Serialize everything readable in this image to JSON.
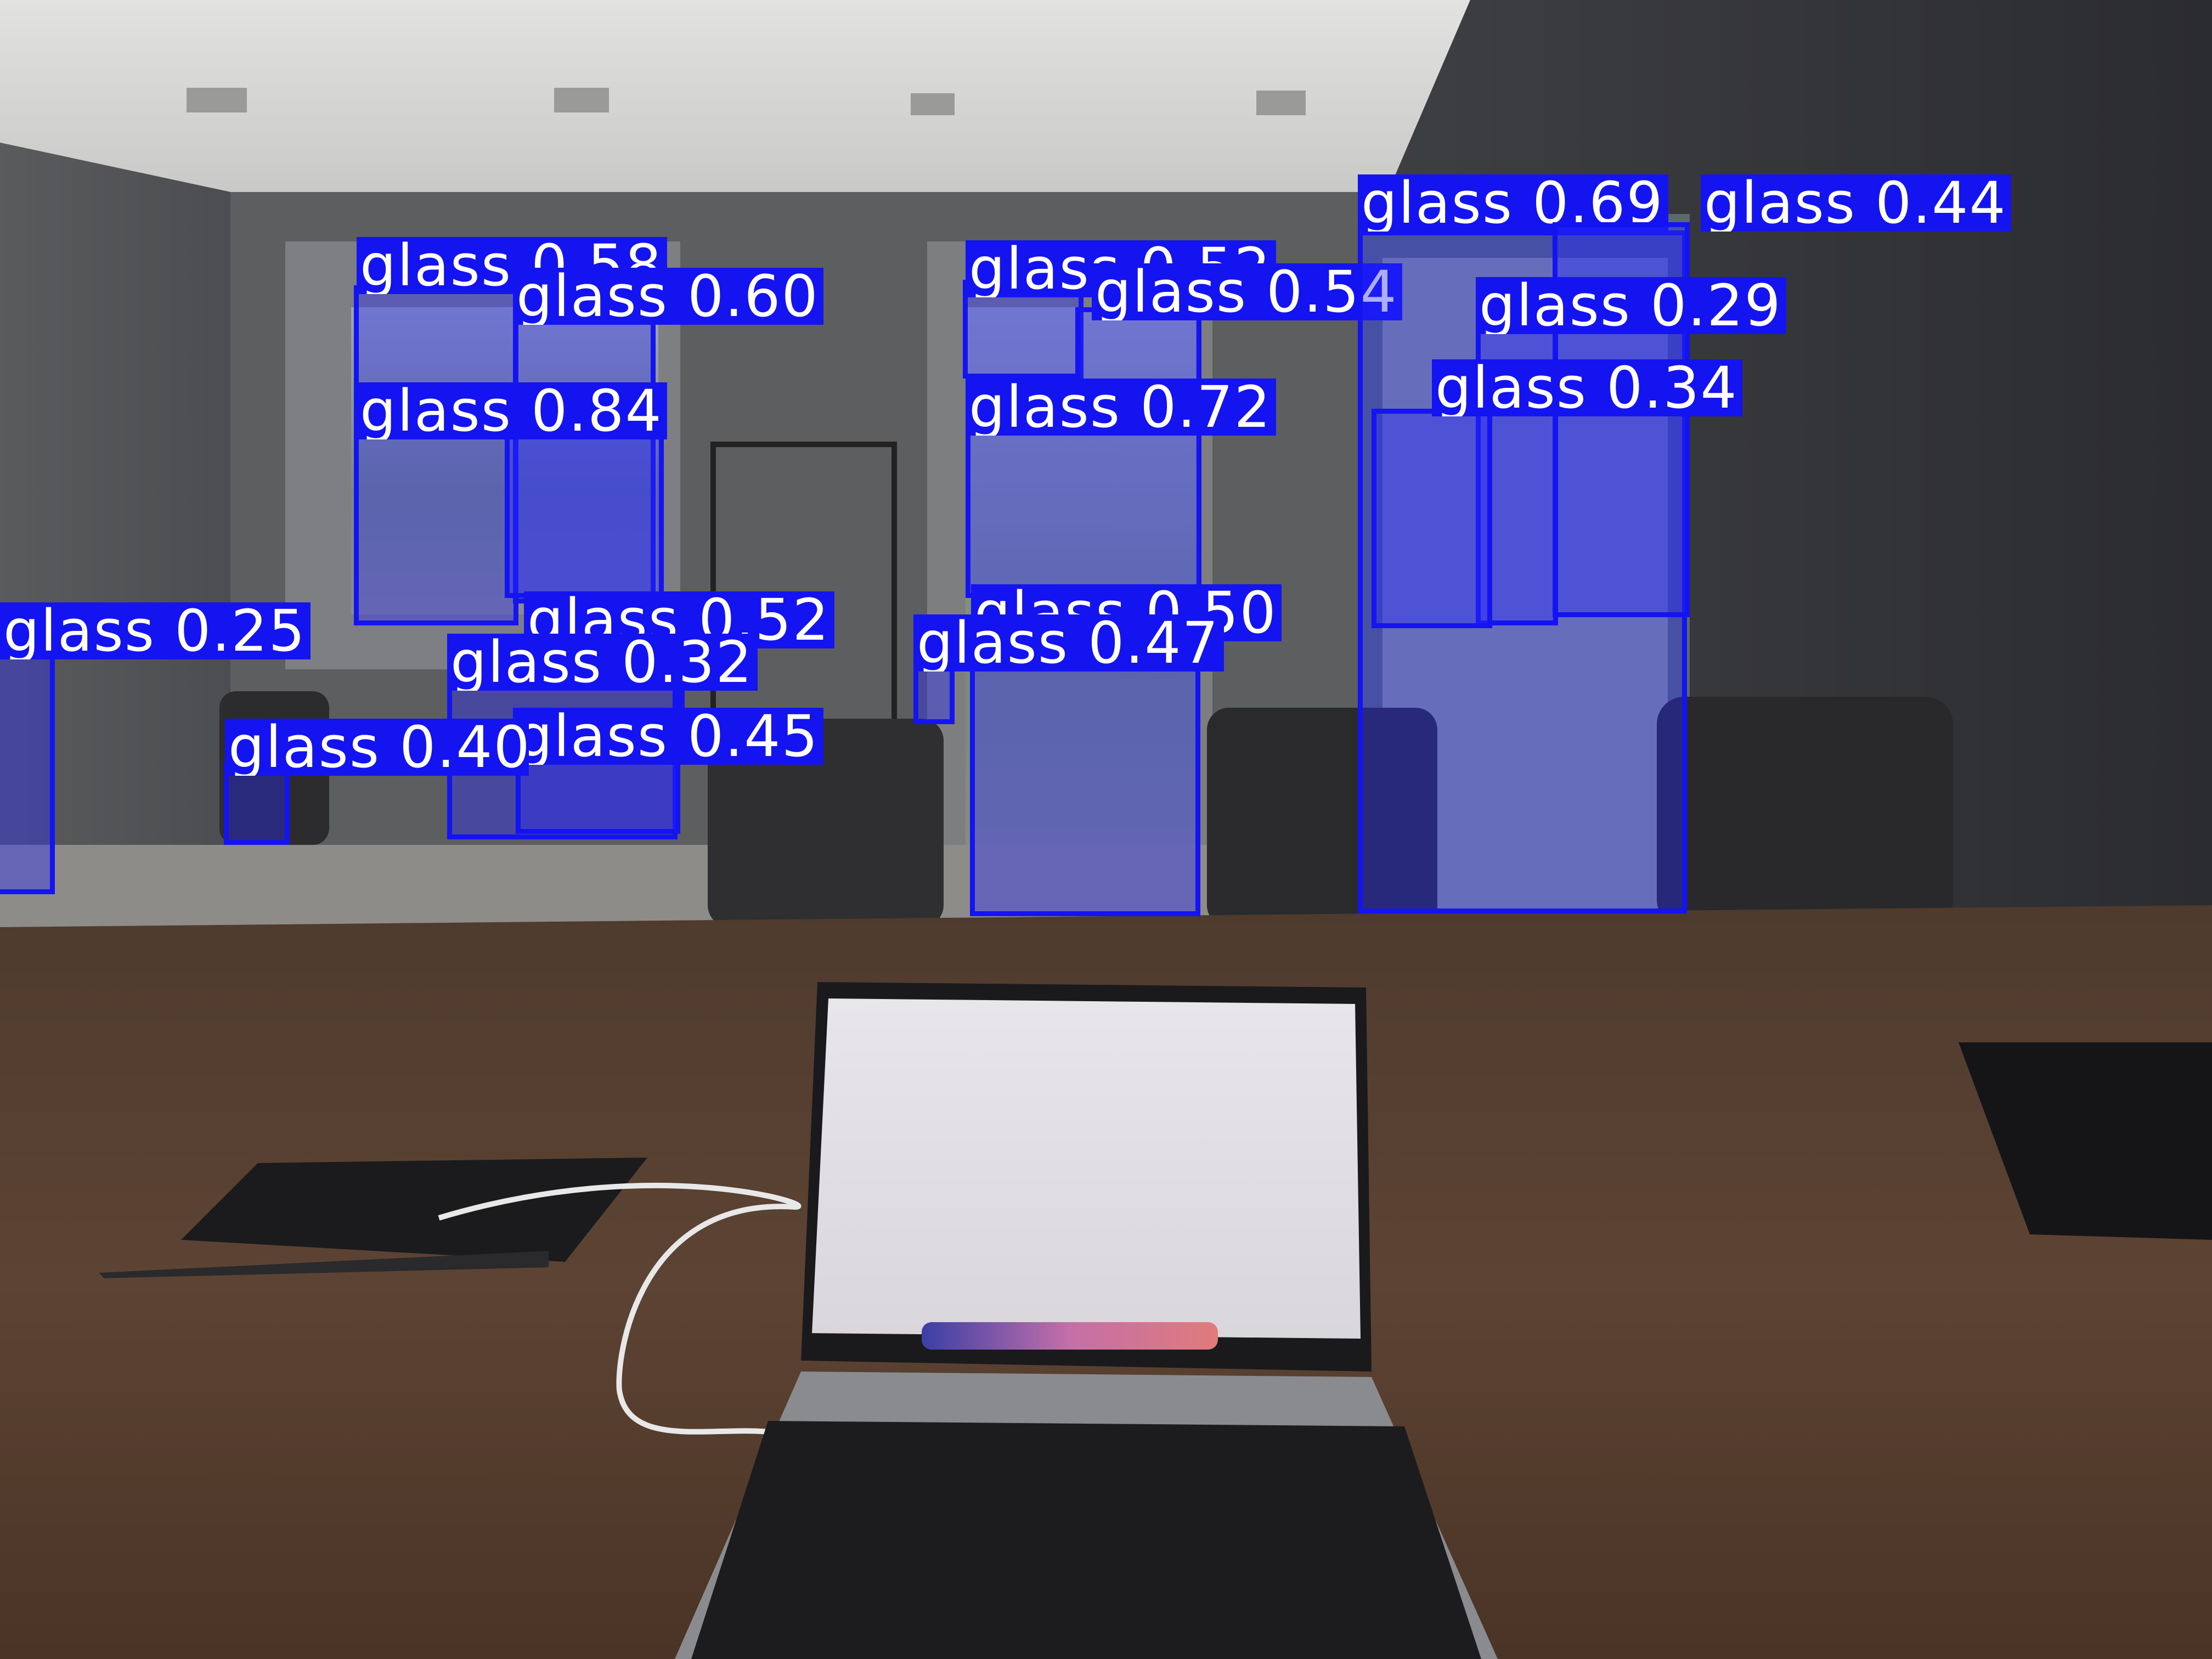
{
  "image": {
    "description_kind": "object-detection overlay on photo of meeting room",
    "box_color": "#1414f0",
    "label_text_color": "#ffffff"
  },
  "detections": [
    {
      "label": "glass 0.25",
      "cls": "glass",
      "score": 0.25
    },
    {
      "label": "glass 0.58",
      "cls": "glass",
      "score": 0.58
    },
    {
      "label": "glass 0.60",
      "cls": "glass",
      "score": 0.6
    },
    {
      "label": "glass 0.84",
      "cls": "glass",
      "score": 0.84
    },
    {
      "label": "glass 0.52",
      "cls": "glass",
      "score": 0.52
    },
    {
      "label": "glass 0.32",
      "cls": "glass",
      "score": 0.32
    },
    {
      "label": "glass 0.45",
      "cls": "glass",
      "score": 0.45
    },
    {
      "label": "glass 0.40",
      "cls": "glass",
      "score": 0.4
    },
    {
      "label": "glass 0.52",
      "cls": "glass",
      "score": 0.52
    },
    {
      "label": "glass 0.54",
      "cls": "glass",
      "score": 0.54
    },
    {
      "label": "glass 0.72",
      "cls": "glass",
      "score": 0.72
    },
    {
      "label": "glass 0.50",
      "cls": "glass",
      "score": 0.5
    },
    {
      "label": "glass 0.47",
      "cls": "glass",
      "score": 0.47
    },
    {
      "label": "glass 0.69",
      "cls": "glass",
      "score": 0.69
    },
    {
      "label": "glass 0.44",
      "cls": "glass",
      "score": 0.44
    },
    {
      "label": "glass 0.29",
      "cls": "glass",
      "score": 0.29
    },
    {
      "label": "glass 0.34",
      "cls": "glass",
      "score": 0.34
    }
  ]
}
